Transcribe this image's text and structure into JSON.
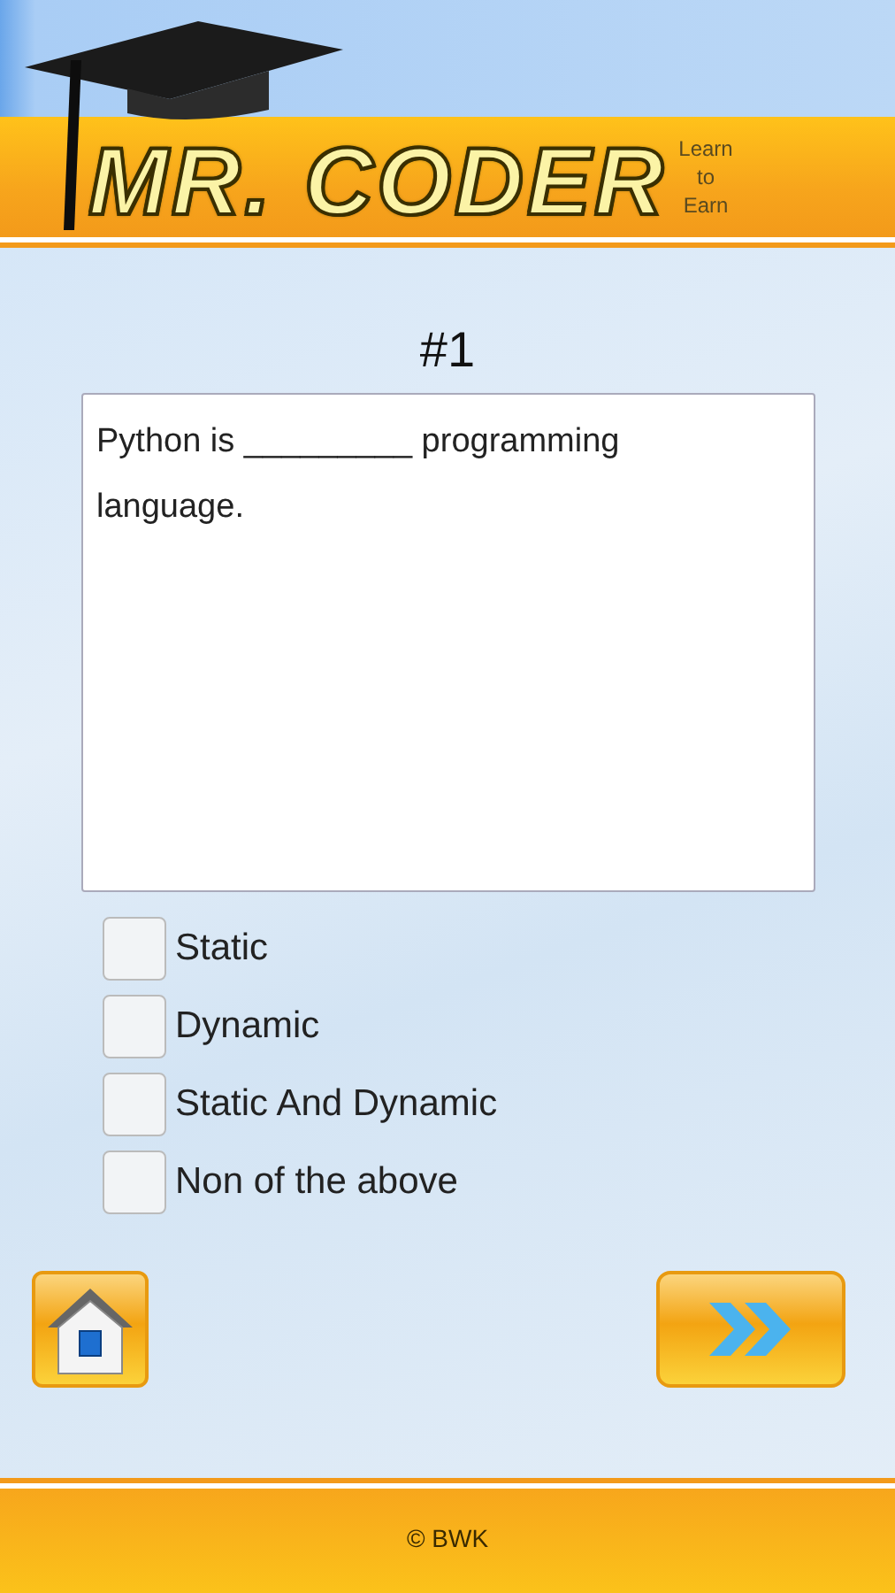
{
  "header": {
    "logo": "MR. CODER",
    "tagline": "Learn to Earn"
  },
  "question": {
    "number": "#1",
    "text": "Python is _________ programming language."
  },
  "options": [
    {
      "label": "Static",
      "checked": false
    },
    {
      "label": "Dynamic",
      "checked": false
    },
    {
      "label": "Static And Dynamic",
      "checked": false
    },
    {
      "label": "Non of the above",
      "checked": false
    }
  ],
  "footer": {
    "copyright": "© BWK"
  }
}
